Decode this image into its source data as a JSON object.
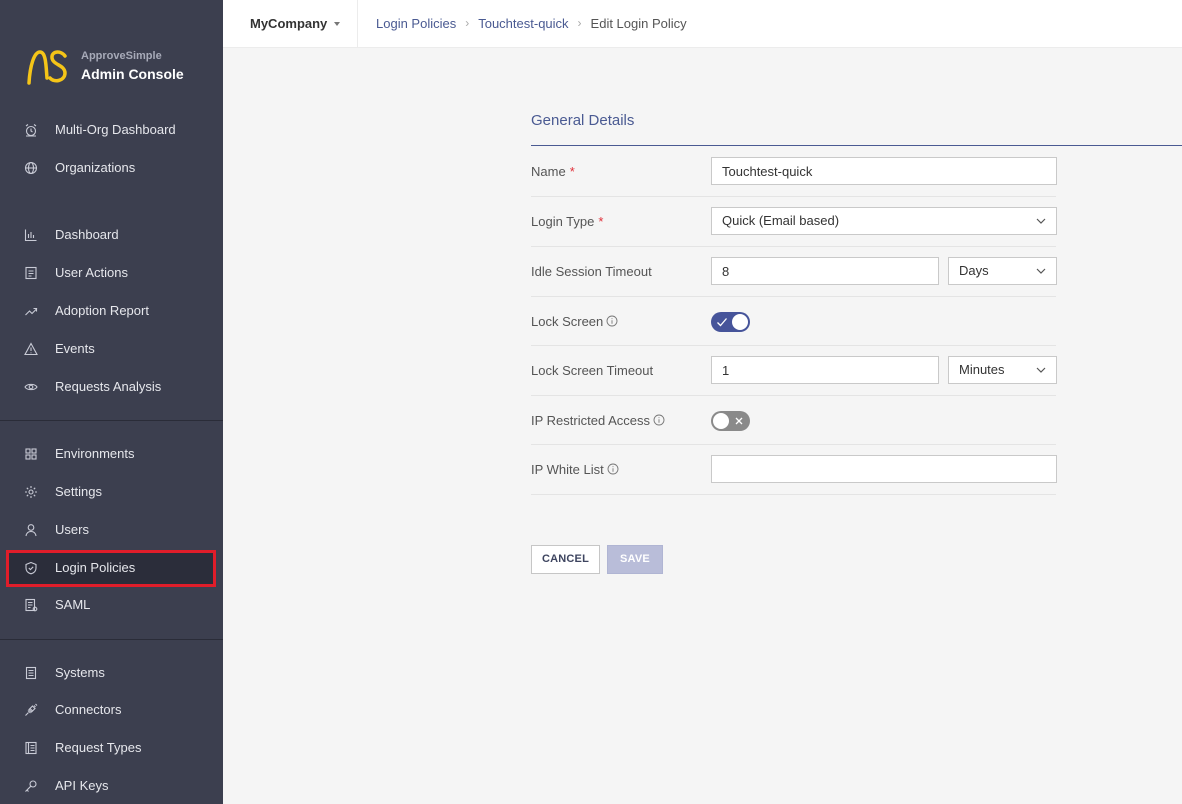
{
  "brand": {
    "subtitle": "ApproveSimple",
    "title": "Admin Console",
    "logo_color": "#f5c518"
  },
  "sidebar": {
    "items": [
      {
        "label": "Multi-Org Dashboard",
        "icon": "alarm-icon"
      },
      {
        "label": "Organizations",
        "icon": "globe-icon"
      },
      {
        "label": "Dashboard",
        "icon": "bar-chart-icon"
      },
      {
        "label": "User Actions",
        "icon": "list-icon"
      },
      {
        "label": "Adoption Report",
        "icon": "trend-icon"
      },
      {
        "label": "Events",
        "icon": "warning-icon"
      },
      {
        "label": "Requests Analysis",
        "icon": "eye-icon"
      },
      {
        "label": "Environments",
        "icon": "grid-icon"
      },
      {
        "label": "Settings",
        "icon": "gear-icon"
      },
      {
        "label": "Users",
        "icon": "user-icon"
      },
      {
        "label": "Login Policies",
        "icon": "shield-icon",
        "active": true
      },
      {
        "label": "SAML",
        "icon": "document-icon"
      },
      {
        "label": "Systems",
        "icon": "server-icon"
      },
      {
        "label": "Connectors",
        "icon": "plug-icon"
      },
      {
        "label": "Request Types",
        "icon": "layout-icon"
      },
      {
        "label": "API Keys",
        "icon": "key-icon"
      }
    ]
  },
  "topbar": {
    "company": "MyCompany",
    "breadcrumb": [
      "Login Policies",
      "Touchtest-quick",
      "Edit Login Policy"
    ]
  },
  "form": {
    "section_title": "General Details",
    "required_mark": "*",
    "name_label": "Name",
    "name_value": "Touchtest-quick",
    "login_type_label": "Login Type",
    "login_type_value": "Quick (Email based)",
    "idle_timeout_label": "Idle Session Timeout",
    "idle_timeout_value": "8",
    "idle_timeout_unit": "Days",
    "lock_screen_label": "Lock Screen",
    "lock_screen_on": true,
    "lock_timeout_label": "Lock Screen Timeout",
    "lock_timeout_value": "1",
    "lock_timeout_unit": "Minutes",
    "ip_restricted_label": "IP Restricted Access",
    "ip_restricted_on": false,
    "ip_whitelist_label": "IP White List",
    "ip_whitelist_value": ""
  },
  "actions": {
    "cancel_label": "CANCEL",
    "save_label": "SAVE"
  },
  "colors": {
    "sidebar_bg": "#3c3f4f",
    "accent": "#4a5a92",
    "toggle_on": "#46549a",
    "highlight": "#e01d2a"
  }
}
